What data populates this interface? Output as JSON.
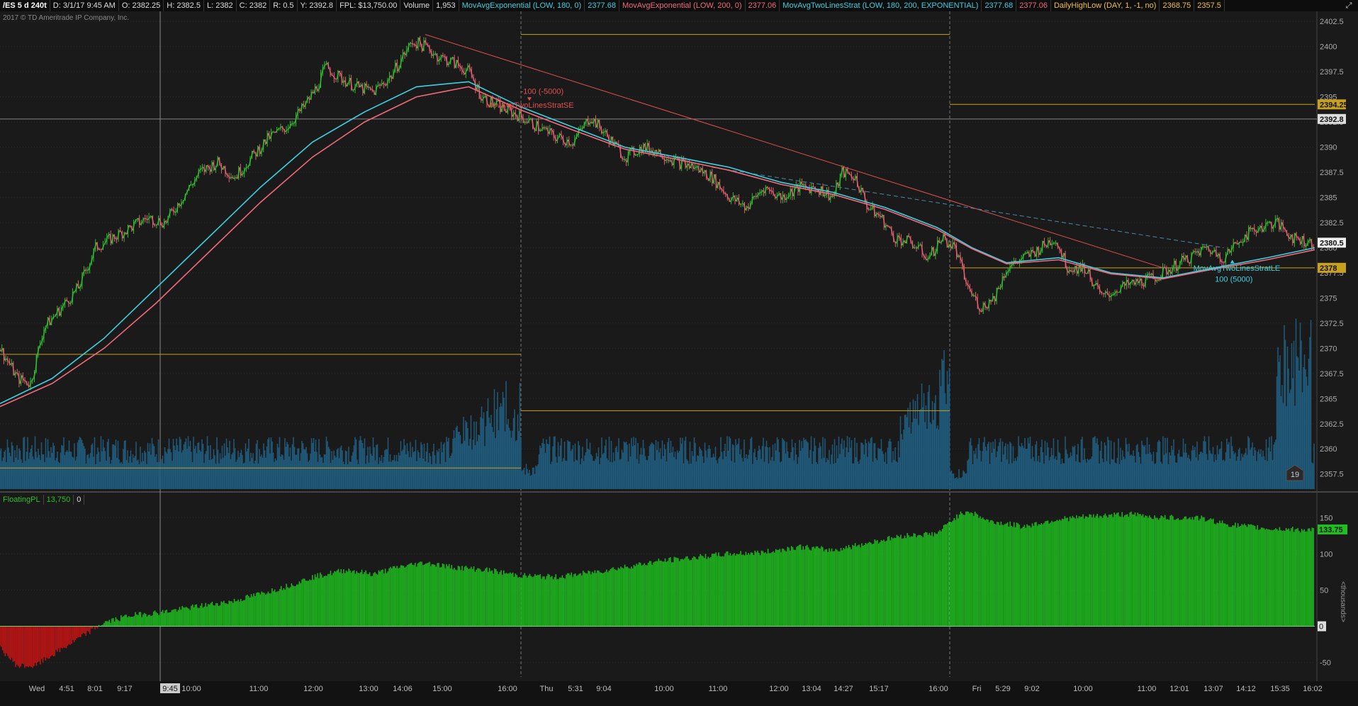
{
  "header": {
    "symbol": "/ES 5 d 240t",
    "date": "D: 3/1/17 9:45 AM",
    "open": "O: 2382.25",
    "high": "H: 2382.5",
    "low": "L: 2382",
    "close": "C: 2382",
    "range": "R: 0.5",
    "y": "Y: 2392.8",
    "fpl": "FPL: $13,750.00",
    "volume_label": "Volume",
    "volume_value": "1,953",
    "ema180_label": "MovAvgExponential (LOW, 180, 0)",
    "ema180_value": "2377.68",
    "ema200_label": "MovAvgExponential (LOW, 200, 0)",
    "ema200_value": "2377.06",
    "strat_label": "MovAvgTwoLinesStrat (LOW, 180, 200, EXPONENTIAL)",
    "strat_v1": "2377.68",
    "strat_v2": "2377.06",
    "dhl_label": "DailyHighLow (DAY, 1, -1, no)",
    "dhl_high": "2368.75",
    "dhl_low": "2357.5"
  },
  "copyright": "2017 © TD Ameritrade IP Company, Inc.",
  "fpl_panel": {
    "label": "FloatingPL",
    "value": "13,750",
    "zero": "0",
    "units": "<thousands>"
  },
  "colors": {
    "background": "#1a1a1a",
    "grid": "#2c2c2c",
    "ema180": "#3fd0e0",
    "ema200": "#f06a7a",
    "trend": "#e05050",
    "daily": "#c8a020",
    "volume": "#1f5a7a",
    "profit": "#1fbf1f",
    "loss": "#c81414",
    "up": "#2fbf2f",
    "down": "#e06070"
  },
  "chart_data": [
    {
      "type": "line",
      "title": "/ES 5 d 240t",
      "price_axis": {
        "ticks": [
          "2402.5",
          "2400",
          "2397.5",
          "2395",
          "2392.5",
          "2390",
          "2387.5",
          "2385",
          "2382.5",
          "2380",
          "2377.5",
          "2375",
          "2372.5",
          "2370",
          "2367.5",
          "2365",
          "2362.5",
          "2360",
          "2357.5"
        ],
        "ylim": [
          2356.0,
          2403.5
        ]
      },
      "x_ticks": [
        "Wed",
        "4:51",
        "8:01",
        "9:17",
        "9:45",
        "10:00",
        "11:00",
        "12:00",
        "13:00",
        "14:06",
        "15:00",
        "16:00",
        "Thu",
        "5:31",
        "9:04",
        "10:00",
        "11:00",
        "12:00",
        "13:04",
        "14:27",
        "15:17",
        "16:00",
        "Fri",
        "5:29",
        "9:02",
        "10:00",
        "11:00",
        "12:01",
        "13:07",
        "14:12",
        "15:35",
        "16:02"
      ],
      "price_tags": {
        "daily_level": "2394.25",
        "cursor": "2392.8",
        "last": "2380.5",
        "ema": "2378"
      },
      "price_path": [
        [
          0,
          2370
        ],
        [
          20,
          2367
        ],
        [
          35,
          2366.5
        ],
        [
          50,
          2372
        ],
        [
          70,
          2374
        ],
        [
          90,
          2376
        ],
        [
          110,
          2380
        ],
        [
          130,
          2381
        ],
        [
          150,
          2382
        ],
        [
          170,
          2383
        ],
        [
          190,
          2382.5
        ],
        [
          210,
          2385
        ],
        [
          230,
          2387.5
        ],
        [
          250,
          2388.5
        ],
        [
          270,
          2387
        ],
        [
          290,
          2389
        ],
        [
          310,
          2391
        ],
        [
          330,
          2392
        ],
        [
          350,
          2394
        ],
        [
          365,
          2396
        ],
        [
          375,
          2398
        ],
        [
          390,
          2397
        ],
        [
          410,
          2396
        ],
        [
          430,
          2395.5
        ],
        [
          450,
          2397
        ],
        [
          460,
          2398.5
        ],
        [
          475,
          2400.5
        ],
        [
          490,
          2400
        ],
        [
          505,
          2399
        ],
        [
          520,
          2398.5
        ],
        [
          540,
          2397.5
        ],
        [
          555,
          2395
        ],
        [
          575,
          2394
        ],
        [
          600,
          2393
        ],
        [
          620,
          2392
        ],
        [
          640,
          2391
        ],
        [
          660,
          2390.5
        ],
        [
          680,
          2393
        ],
        [
          700,
          2391
        ],
        [
          720,
          2389
        ],
        [
          740,
          2390
        ],
        [
          760,
          2389.5
        ],
        [
          780,
          2388.5
        ],
        [
          800,
          2388
        ],
        [
          820,
          2387
        ],
        [
          840,
          2385
        ],
        [
          860,
          2384
        ],
        [
          880,
          2386
        ],
        [
          900,
          2385
        ],
        [
          920,
          2386
        ],
        [
          940,
          2386
        ],
        [
          960,
          2385
        ],
        [
          970,
          2387.5
        ],
        [
          985,
          2387
        ],
        [
          1000,
          2384
        ],
        [
          1015,
          2383
        ],
        [
          1030,
          2381
        ],
        [
          1050,
          2380.5
        ],
        [
          1070,
          2379
        ],
        [
          1085,
          2381
        ],
        [
          1100,
          2380
        ],
        [
          1115,
          2376
        ],
        [
          1130,
          2374
        ],
        [
          1145,
          2375
        ],
        [
          1160,
          2378
        ],
        [
          1180,
          2379
        ],
        [
          1200,
          2380
        ],
        [
          1215,
          2381
        ],
        [
          1230,
          2378
        ],
        [
          1250,
          2378
        ],
        [
          1270,
          2375
        ],
        [
          1290,
          2376
        ],
        [
          1310,
          2376.5
        ],
        [
          1330,
          2377
        ],
        [
          1350,
          2378
        ],
        [
          1370,
          2379
        ],
        [
          1390,
          2380
        ],
        [
          1410,
          2379
        ],
        [
          1430,
          2381
        ],
        [
          1450,
          2382
        ],
        [
          1470,
          2382.5
        ],
        [
          1490,
          2381
        ],
        [
          1510,
          2380.5
        ]
      ],
      "series": [
        {
          "name": "MovAvgExponential (LOW, 180, 0)",
          "values": [
            [
              0,
              2364.5
            ],
            [
              60,
              2367
            ],
            [
              120,
              2371
            ],
            [
              180,
              2376
            ],
            [
              240,
              2381
            ],
            [
              300,
              2386
            ],
            [
              360,
              2390.5
            ],
            [
              420,
              2393.5
            ],
            [
              480,
              2396
            ],
            [
              540,
              2396.5
            ],
            [
              600,
              2394
            ],
            [
              660,
              2392
            ],
            [
              720,
              2390
            ],
            [
              780,
              2389
            ],
            [
              840,
              2388
            ],
            [
              900,
              2386.5
            ],
            [
              960,
              2385.5
            ],
            [
              1020,
              2384
            ],
            [
              1080,
              2382
            ],
            [
              1120,
              2380
            ],
            [
              1160,
              2378.5
            ],
            [
              1220,
              2379
            ],
            [
              1280,
              2377.5
            ],
            [
              1340,
              2377
            ],
            [
              1400,
              2378
            ],
            [
              1460,
              2379
            ],
            [
              1515,
              2380
            ]
          ]
        },
        {
          "name": "MovAvgExponential (LOW, 200, 0)",
          "values": [
            [
              0,
              2364.2
            ],
            [
              60,
              2366.5
            ],
            [
              120,
              2370
            ],
            [
              180,
              2374.5
            ],
            [
              240,
              2379.5
            ],
            [
              300,
              2384.5
            ],
            [
              360,
              2389
            ],
            [
              420,
              2392.5
            ],
            [
              480,
              2395
            ],
            [
              540,
              2396
            ],
            [
              600,
              2393.7
            ],
            [
              660,
              2391.7
            ],
            [
              720,
              2389.8
            ],
            [
              780,
              2388.8
            ],
            [
              840,
              2387.7
            ],
            [
              900,
              2386.3
            ],
            [
              960,
              2385.3
            ],
            [
              1020,
              2383.8
            ],
            [
              1080,
              2381.8
            ],
            [
              1120,
              2379.9
            ],
            [
              1160,
              2378.4
            ],
            [
              1220,
              2378.8
            ],
            [
              1280,
              2377.4
            ],
            [
              1340,
              2376.9
            ],
            [
              1400,
              2377.9
            ],
            [
              1460,
              2378.8
            ],
            [
              1515,
              2379.8
            ]
          ]
        }
      ],
      "volume": {
        "label": "Volume",
        "badge": "19"
      },
      "annotations": [
        {
          "text": "-100 (-5000)",
          "x": 600,
          "y": 2395.3
        },
        {
          "text": "MovAvgTwoLinesStratSE",
          "x": 560,
          "y": 2393.9
        },
        {
          "text": "MovAvgTwoLinesStratLE",
          "x": 1375,
          "y": 2377.7
        },
        {
          "text": "100 (5000)",
          "x": 1400,
          "y": 2376.6
        }
      ]
    },
    {
      "type": "bar",
      "title": "FloatingPL",
      "ticks": [
        "150",
        "100",
        "50",
        "0",
        "-50"
      ],
      "ylim": [
        -70,
        165
      ],
      "value_tag": "133.75",
      "profile": [
        [
          0,
          -30
        ],
        [
          20,
          -55
        ],
        [
          40,
          -55
        ],
        [
          60,
          -40
        ],
        [
          80,
          -25
        ],
        [
          100,
          -10
        ],
        [
          120,
          5
        ],
        [
          150,
          15
        ],
        [
          190,
          20
        ],
        [
          230,
          28
        ],
        [
          270,
          35
        ],
        [
          300,
          45
        ],
        [
          330,
          55
        ],
        [
          360,
          68
        ],
        [
          400,
          78
        ],
        [
          430,
          72
        ],
        [
          460,
          82
        ],
        [
          490,
          88
        ],
        [
          520,
          82
        ],
        [
          560,
          78
        ],
        [
          600,
          70
        ],
        [
          640,
          68
        ],
        [
          680,
          74
        ],
        [
          720,
          82
        ],
        [
          760,
          90
        ],
        [
          800,
          95
        ],
        [
          840,
          100
        ],
        [
          880,
          102
        ],
        [
          920,
          110
        ],
        [
          960,
          105
        ],
        [
          1000,
          115
        ],
        [
          1040,
          125
        ],
        [
          1080,
          128
        ],
        [
          1100,
          150
        ],
        [
          1115,
          160
        ],
        [
          1140,
          145
        ],
        [
          1180,
          138
        ],
        [
          1220,
          148
        ],
        [
          1260,
          152
        ],
        [
          1300,
          155
        ],
        [
          1340,
          150
        ],
        [
          1380,
          150
        ],
        [
          1420,
          140
        ],
        [
          1460,
          135
        ],
        [
          1510,
          133
        ]
      ]
    }
  ]
}
